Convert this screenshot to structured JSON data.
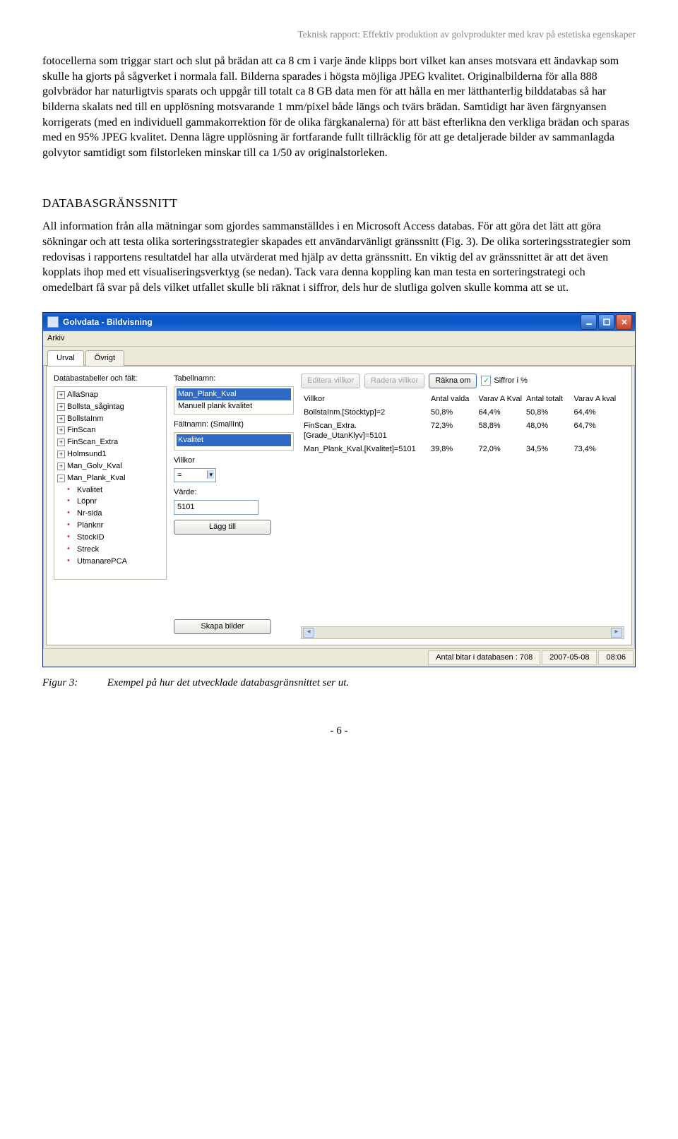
{
  "header": "Teknisk rapport: Effektiv produktion av golvprodukter med krav på estetiska egenskaper",
  "para1": "fotocellerna som triggar start och slut på brädan att ca 8 cm i varje ände klipps bort vilket kan anses motsvara ett ändavkap som skulle ha gjorts på sågverket i normala fall. Bilderna sparades i högsta möjliga JPEG kvalitet. Originalbilderna för alla 888 golvbrädor har naturligtvis sparats och uppgår till totalt ca 8 GB data men för att hålla en mer lätthanterlig bilddatabas så har bilderna skalats ned till en upplösning motsvarande 1 mm/pixel både längs och tvärs brädan. Samtidigt har även färgnyansen korrigerats (med en individuell gammakorrektion för de olika färgkanalerna) för att bäst efterlikna den verkliga brädan och sparas med en 95% JPEG kvalitet. Denna lägre upplösning är fortfarande fullt tillräcklig för att ge detaljerade bilder av sammanlagda golvytor samtidigt som filstorleken minskar till ca 1/50 av originalstorleken.",
  "section_title": "DATABASGRÄNSSNITT",
  "para2": "All information från alla mätningar som gjordes sammanställdes i en Microsoft Access databas. För att göra det lätt att göra sökningar och att testa olika sorteringsstrategier skapades ett användarvänligt gränssnitt (Fig. 3). De olika sorteringsstrategier som redovisas i rapportens resultatdel har alla utvärderat med hjälp av detta gränssnitt. En viktig del av gränssnittet är att det även kopplats ihop med ett visualiseringsverktyg (se nedan). Tack vara denna koppling kan man testa en sorteringstrategi och omedelbart få svar på dels vilket utfallet skulle bli räknat i siffror, dels hur de slutliga golven skulle komma att se ut.",
  "fig_label": "Figur 3:",
  "fig_text": "Exempel på hur det utvecklade databasgränsnittet ser ut.",
  "page_no": "- 6 -",
  "app": {
    "title": "Golvdata - Bildvisning",
    "menu": "Arkiv",
    "tabs": {
      "active": "Urval",
      "other": "Övrigt"
    },
    "labels": {
      "db_tables": "Databastabeller och fält:",
      "table_name": "Tabellnamn:",
      "field_name": "Fältnamn: (SmallInt)",
      "villkor": "Villkor",
      "value": "Värde:"
    },
    "tree": {
      "items": [
        "AllaSnap",
        "Bollsta_sågintag",
        "BollstaInm",
        "FinScan",
        "FinScan_Extra",
        "Holmsund1",
        "Man_Golv_Kval",
        "Man_Plank_Kval"
      ],
      "open": "Man_Plank_Kval",
      "children": [
        "Kvalitet",
        "Löpnr",
        "Nr-sida",
        "Planknr",
        "StockID",
        "Streck",
        "UtmanarePCA"
      ]
    },
    "tablebox": {
      "rows": [
        "Man_Plank_Kval",
        "Manuell plank kvalitet"
      ],
      "sel": 0
    },
    "fieldbox": {
      "rows": [
        "Kvalitet"
      ],
      "sel": 0
    },
    "villkor_op": "=",
    "value_text": "5101",
    "btn_lagg": "Lägg till",
    "btn_skapa": "Skapa bilder",
    "right_top": {
      "btn_edit": "Editera villkor",
      "btn_del": "Radera villkor",
      "btn_recalc": "Räkna om",
      "chk": "Siffror i %"
    },
    "table": {
      "head": [
        "Villkor",
        "Antal valda",
        "Varav A Kval",
        "Antal totalt",
        "Varav A kval"
      ],
      "rows": [
        [
          "BollstaInm.[Stocktyp]=2",
          "50,8%",
          "64,4%",
          "50,8%",
          "64,4%"
        ],
        [
          "FinScan_Extra.[Grade_UtanKlyv]=5101",
          "72,3%",
          "58,8%",
          "48,0%",
          "64,7%"
        ],
        [
          "Man_Plank_Kval.[Kvalitet]=5101",
          "39,8%",
          "72,0%",
          "34,5%",
          "73,4%"
        ]
      ]
    },
    "status": {
      "count": "Antal bitar i databasen : 708",
      "date": "2007-05-08",
      "time": "08:06"
    }
  }
}
